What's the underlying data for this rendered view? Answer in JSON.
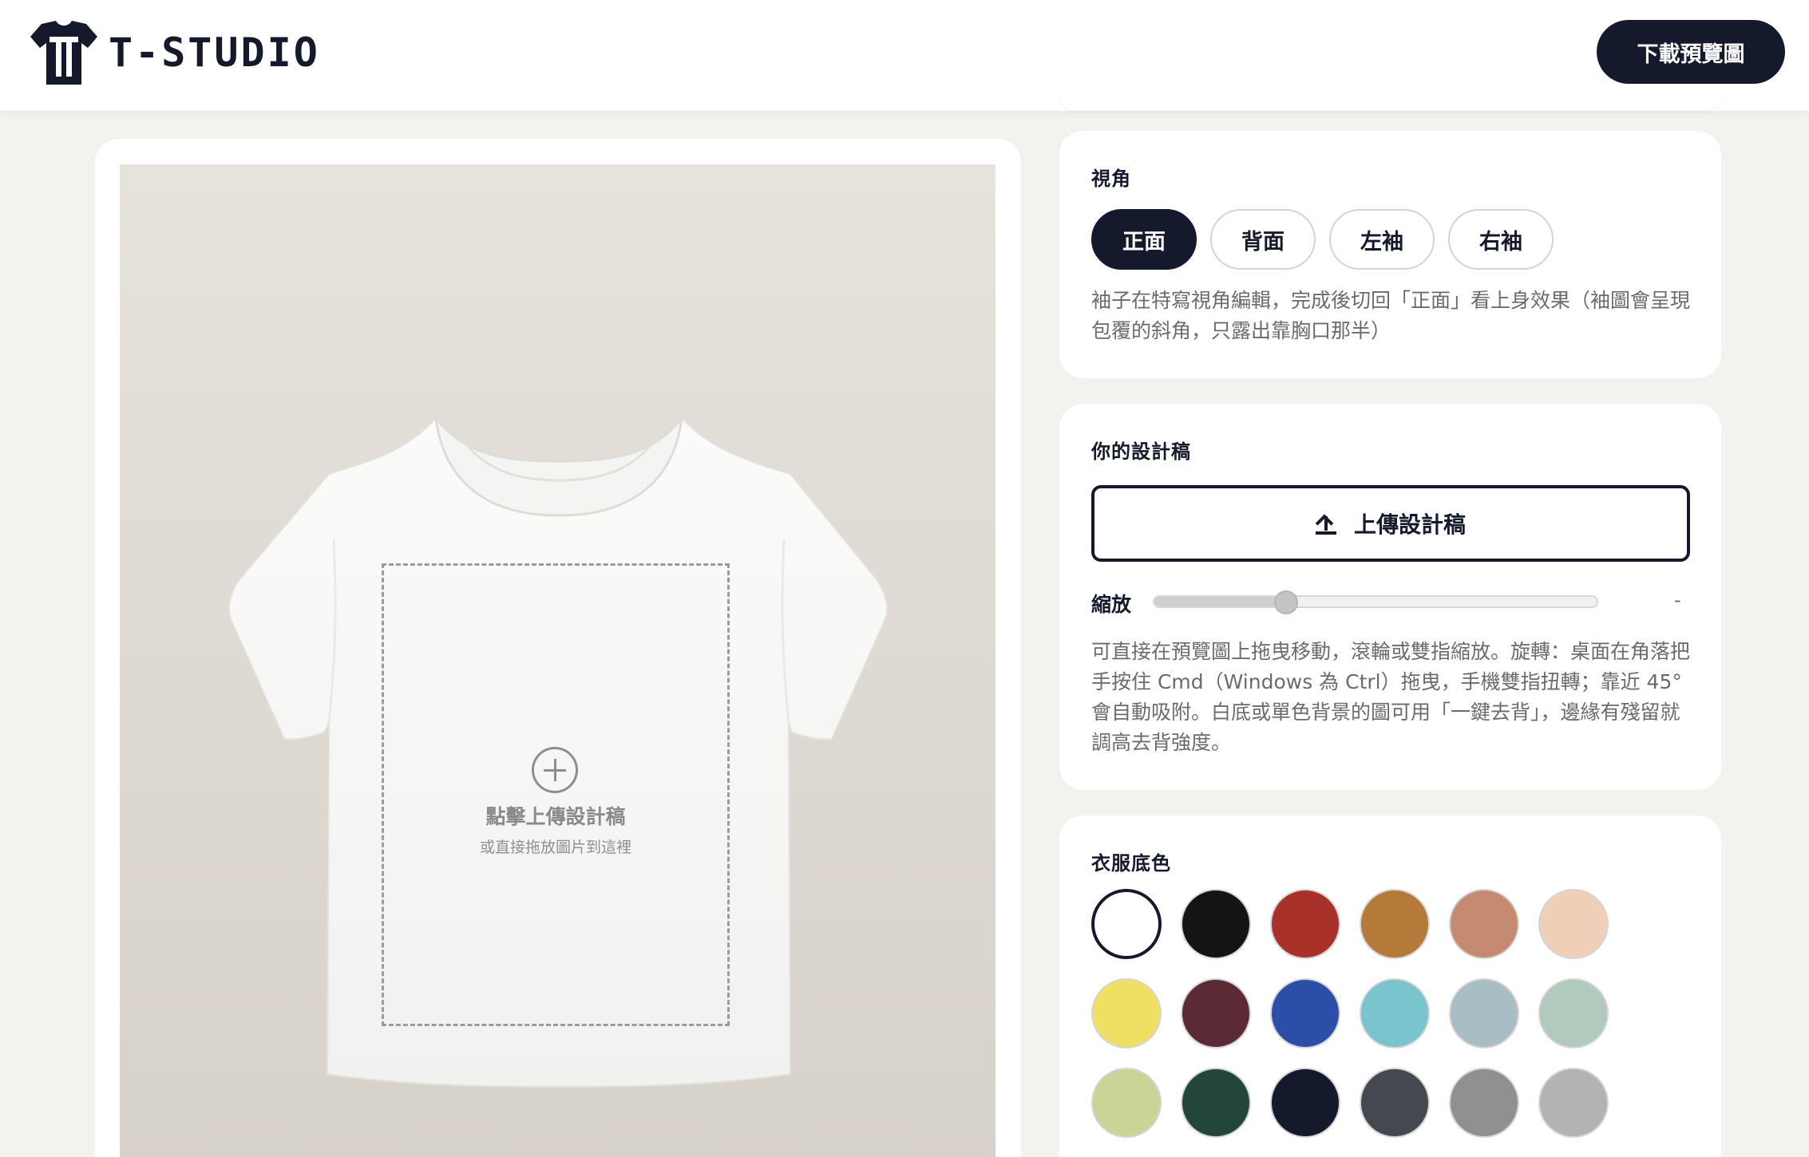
{
  "header": {
    "brand": "T-STUDIO",
    "download_label": "下載預覽圖"
  },
  "preview": {
    "drop_title": "點擊上傳設計稿",
    "drop_subtitle": "或直接拖放圖片到這裡"
  },
  "view_panel": {
    "title": "視角",
    "tabs": [
      {
        "label": "正面",
        "active": true
      },
      {
        "label": "背面",
        "active": false
      },
      {
        "label": "左袖",
        "active": false
      },
      {
        "label": "右袖",
        "active": false
      }
    ],
    "hint": "袖子在特寫視角編輯，完成後切回「正面」看上身效果（袖圖會呈現包覆的斜角，只露出靠胸口那半）"
  },
  "design_panel": {
    "title": "你的設計稿",
    "upload_label": "上傳設計稿",
    "zoom_label": "縮放",
    "zoom_level": 0.3,
    "zoom_value": "-",
    "hint": "可直接在預覽圖上拖曳移動，滾輪或雙指縮放。旋轉：桌面在角落把手按住 Cmd（Windows 為 Ctrl）拖曳，手機雙指扭轉；靠近 45° 會自動吸附。白底或單色背景的圖可用「一鍵去背」，邊緣有殘留就調高去背強度。"
  },
  "color_panel": {
    "title": "衣服底色",
    "selected_index": 0,
    "colors": [
      "#ffffff",
      "#141414",
      "#a8322a",
      "#b37a3a",
      "#c48b70",
      "#efcfb7",
      "#efdf62",
      "#5a2a35",
      "#2b4fa6",
      "#7ac4cd",
      "#a9bdc4",
      "#b2c9bd",
      "#c9d596",
      "#234639",
      "#141a2b",
      "#44484f",
      "#8f9091",
      "#b2b3b4"
    ]
  },
  "theme": {
    "accent": "#141a2b",
    "shirt": "#f7f7f6"
  }
}
